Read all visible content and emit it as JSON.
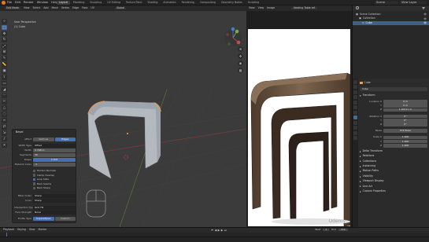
{
  "menu": [
    "File",
    "Edit",
    "Render",
    "Window",
    "Help"
  ],
  "workspace_tabs": [
    "Layout",
    "Modeling",
    "Sculpting",
    "UV Editing",
    "Texture Paint",
    "Shading",
    "Animation",
    "Rendering",
    "Compositing",
    "Geometry Nodes",
    "Scripting"
  ],
  "scene_name": "Scene",
  "view_layer": "View Layer",
  "viewport": {
    "mode": "Edit Mode",
    "header_items": [
      "View",
      "Select",
      "Add",
      "Mesh",
      "Vertex",
      "Edge",
      "Face",
      "UV"
    ],
    "transform": "Global",
    "info_line1": "User Perspective",
    "info_line2": "(1) Cube"
  },
  "tools": [
    "cursor",
    "select-box",
    "move",
    "rotate",
    "scale",
    "transform",
    "annotate",
    "measure",
    "add-cube",
    "extrude",
    "inset",
    "bevel",
    "loop-cut",
    "knife",
    "poly-build",
    "spin",
    "smooth",
    "edge-slide",
    "shrink",
    "shear",
    "rip"
  ],
  "operator_panel": {
    "title": "Bevel",
    "affect_label": "Affect",
    "affect_options": [
      "Vertices",
      "Edges"
    ],
    "affect_selected": "Edges",
    "rows": [
      {
        "label": "Width Type",
        "value": "Offset"
      },
      {
        "label": "Width",
        "value": "0.798 m"
      },
      {
        "label": "Segments",
        "value": "30"
      },
      {
        "label": "Shape",
        "value": "0.500"
      },
      {
        "label": "Material Index",
        "value": "-1"
      }
    ],
    "checks": [
      {
        "label": "Harden Normals",
        "on": false
      },
      {
        "label": "Clamp Overlap",
        "on": false
      },
      {
        "label": "Loop Slide",
        "on": true
      },
      {
        "label": "Mark Seams",
        "on": false
      },
      {
        "label": "Mark Sharp",
        "on": false
      }
    ],
    "miter_outer_label": "Miter Outer",
    "miter_outer": "Sharp",
    "inner_label": "Inner",
    "inner": "Sharp",
    "intersection_label": "Intersection Type",
    "intersection": "Grid Fill",
    "face_strength_label": "Face Strength",
    "face_strength": "None",
    "profile_label": "Profile Type",
    "profile_options": [
      "Superellipse",
      "Custom"
    ],
    "profile_selected": "Superellipse"
  },
  "render_view": {
    "header_items": [
      "View",
      "View",
      "Image"
    ],
    "image_name": "Nesting Table ref"
  },
  "outliner": {
    "title": "Scene Collection",
    "items": [
      {
        "label": "Scene Collection",
        "selected": false
      },
      {
        "label": "Collection",
        "selected": false
      },
      {
        "label": "Cube",
        "selected": true
      }
    ]
  },
  "properties": {
    "object_name": "Cube",
    "object_name_field": "Cube",
    "transform_label": "Transform",
    "rows": [
      {
        "label": "Location X",
        "value": "0 m"
      },
      {
        "label": "Y",
        "value": "0 m"
      },
      {
        "label": "Z",
        "value": "1.00711 m"
      },
      {
        "label": "Rotation X",
        "value": "0°"
      },
      {
        "label": "Y",
        "value": "0°"
      },
      {
        "label": "Z",
        "value": "0°"
      },
      {
        "label": "Mode",
        "value": "XYZ Euler"
      },
      {
        "label": "Scale X",
        "value": "1.000"
      },
      {
        "label": "Y",
        "value": "1.000"
      },
      {
        "label": "Z",
        "value": "1.000"
      }
    ],
    "sections": [
      "Delta Transform",
      "Relations",
      "Collections",
      "Instancing",
      "Motion Paths",
      "Visibility",
      "Viewport Display",
      "Line Art",
      "Custom Properties"
    ]
  },
  "timeline": {
    "items": [
      "Playback",
      "Keying",
      "View",
      "Marker"
    ],
    "start_label": "Start",
    "start": "1",
    "end_label": "End",
    "end": "250"
  },
  "watermark": "Udemy",
  "colors": {
    "accent": "#4772b3",
    "selection": "#3f5f8f",
    "mesh_face": "#b4b8bf",
    "mesh_edge_selected": "#e39a5a",
    "wood_dark": "#4c3a2c",
    "wood_light": "#7d654e"
  }
}
